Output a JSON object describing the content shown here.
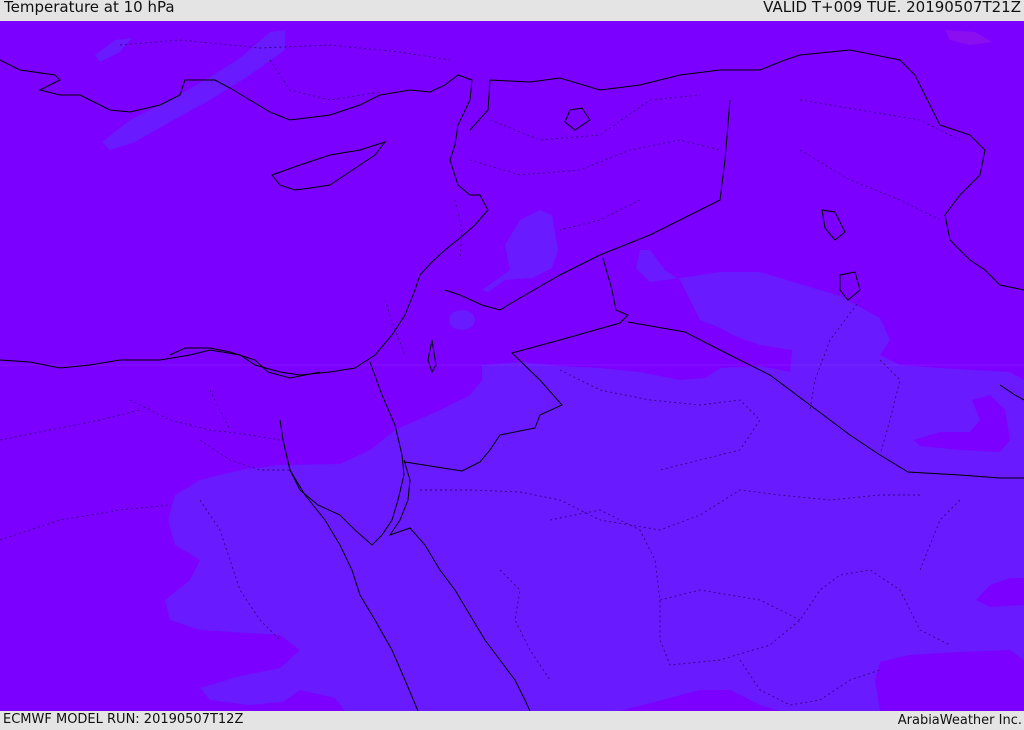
{
  "header": {
    "title": "Temperature at 10 hPa",
    "valid_time": "VALID T+009 TUE. 20190507T21Z"
  },
  "footer": {
    "model_run": "ECMWF MODEL RUN: 20190507T12Z",
    "brand": "ArabiaWeather Inc."
  },
  "map": {
    "variable": "temperature",
    "pressure_level": "10 hPa",
    "colors": {
      "background_field": "#7b00ff",
      "cooler_field": "#6a1aff",
      "warmer_patch": "#8a0ef0",
      "border_line": "#000000"
    }
  }
}
